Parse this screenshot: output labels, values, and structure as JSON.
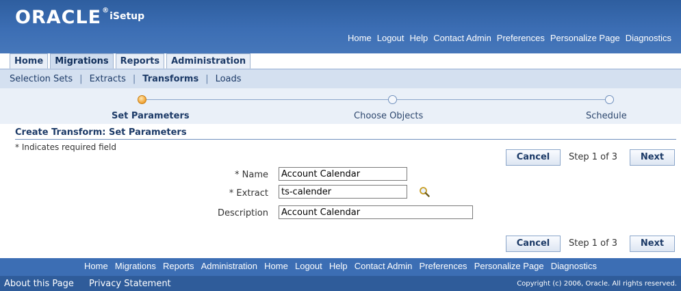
{
  "header": {
    "brand": "ORACLE",
    "reg_mark": "®",
    "product": "iSetup",
    "global_links": [
      "Home",
      "Logout",
      "Help",
      "Contact Admin",
      "Preferences",
      "Personalize Page",
      "Diagnostics"
    ]
  },
  "tabs": [
    "Home",
    "Migrations",
    "Reports",
    "Administration"
  ],
  "active_tab": "Migrations",
  "subnav": [
    "Selection Sets",
    "Extracts",
    "Transforms",
    "Loads"
  ],
  "active_subnav": "Transforms",
  "train": {
    "steps": [
      "Set Parameters",
      "Choose Objects",
      "Schedule"
    ],
    "current": 0
  },
  "page": {
    "title": "Create Transform: Set Parameters",
    "required_note": "* Indicates required field",
    "cancel_label": "Cancel",
    "next_label": "Next",
    "step_text": "Step 1 of 3"
  },
  "form": {
    "name_label": "* Name",
    "name_value": "Account Calendar",
    "extract_label": "* Extract",
    "extract_value": "ts-calender",
    "description_label": "Description",
    "description_value": "Account Calendar"
  },
  "footer": {
    "links": [
      "Home",
      "Migrations",
      "Reports",
      "Administration",
      "Home",
      "Logout",
      "Help",
      "Contact Admin",
      "Preferences",
      "Personalize Page",
      "Diagnostics"
    ],
    "about": "About this Page",
    "privacy": "Privacy Statement",
    "copyright": "Copyright (c) 2006, Oracle. All rights reserved."
  },
  "colors": {
    "header_blue": "#3c6eb4",
    "accent_orange": "#f0a030"
  },
  "icons": {
    "search": "magnifier-icon"
  }
}
